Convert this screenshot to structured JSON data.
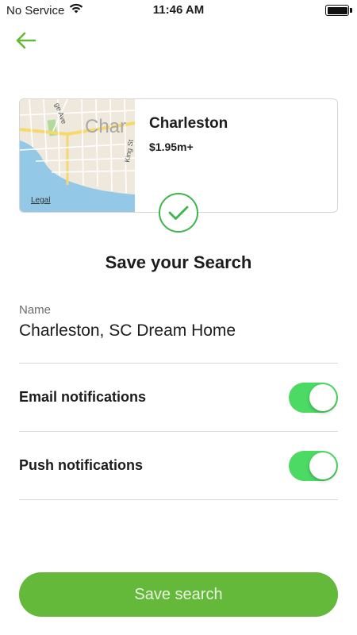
{
  "status_bar": {
    "carrier": "No Service",
    "time": "11:46 AM"
  },
  "result_card": {
    "title": "Charleston",
    "price": "$1.95m+",
    "map": {
      "city_label": "Char",
      "street_labels": [
        "ge Ave",
        "King St"
      ],
      "legal": "Legal"
    }
  },
  "heading": "Save your Search",
  "name_field": {
    "label": "Name",
    "value": "Charleston, SC Dream Home"
  },
  "notifications": [
    {
      "label": "Email notifications",
      "enabled": true
    },
    {
      "label": "Push notifications",
      "enabled": true
    }
  ],
  "save_button": {
    "label": "Save search"
  },
  "colors": {
    "accent_green": "#64b93b",
    "toggle_green": "#4cd964",
    "check_green": "#3cb54a"
  }
}
